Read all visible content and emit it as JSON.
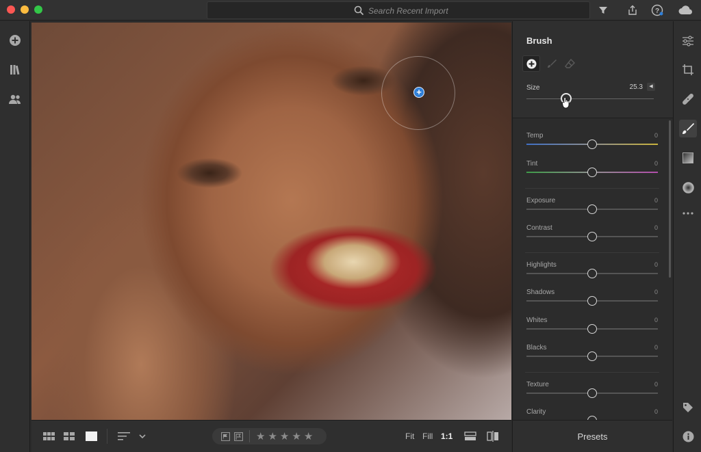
{
  "window": {
    "traffic_colors": [
      "#fc5753",
      "#fdbc40",
      "#33c748"
    ]
  },
  "search": {
    "placeholder": "Search Recent Import",
    "icon": "search-icon"
  },
  "top_icons": [
    "filter-icon",
    "share-icon",
    "help-icon",
    "cloud-icon"
  ],
  "left_rail": {
    "items": [
      "add-photos-icon",
      "library-icon",
      "people-icon"
    ]
  },
  "photo": {
    "brush_cursor": "brush-add-pin-icon"
  },
  "bottom_bar": {
    "view_icons": [
      "grid-large-icon",
      "grid-small-icon",
      "single-view-icon"
    ],
    "sort_icon": "sort-icon",
    "flags": [
      "flag-pick-icon",
      "flag-reject-icon"
    ],
    "stars": [
      "★",
      "★",
      "★",
      "★",
      "★"
    ],
    "fit_label": "Fit",
    "fill_label": "Fill",
    "one_to_one_label": "1:1",
    "right_icons": [
      "compare-icon",
      "before-after-icon"
    ]
  },
  "panel": {
    "title": "Brush",
    "tools": [
      "add-brush-icon",
      "brush-icon",
      "erase-icon"
    ],
    "size": {
      "label": "Size",
      "value": "25.3",
      "fraction": 0.27
    },
    "sliders": [
      {
        "label": "Temp",
        "value": "0"
      },
      {
        "label": "Tint",
        "value": "0"
      },
      {
        "label": "Exposure",
        "value": "0"
      },
      {
        "label": "Contrast",
        "value": "0"
      },
      {
        "label": "Highlights",
        "value": "0"
      },
      {
        "label": "Shadows",
        "value": "0"
      },
      {
        "label": "Whites",
        "value": "0"
      },
      {
        "label": "Blacks",
        "value": "0"
      },
      {
        "label": "Texture",
        "value": "0"
      },
      {
        "label": "Clarity",
        "value": "0"
      }
    ]
  },
  "presets_label": "Presets",
  "right_rail": {
    "items": [
      "edit-sliders-icon",
      "crop-icon",
      "healing-icon",
      "brush-tool-icon",
      "linear-gradient-icon",
      "radial-gradient-icon",
      "more-icon",
      "tag-icon",
      "info-icon"
    ],
    "active": "brush-tool-icon"
  }
}
